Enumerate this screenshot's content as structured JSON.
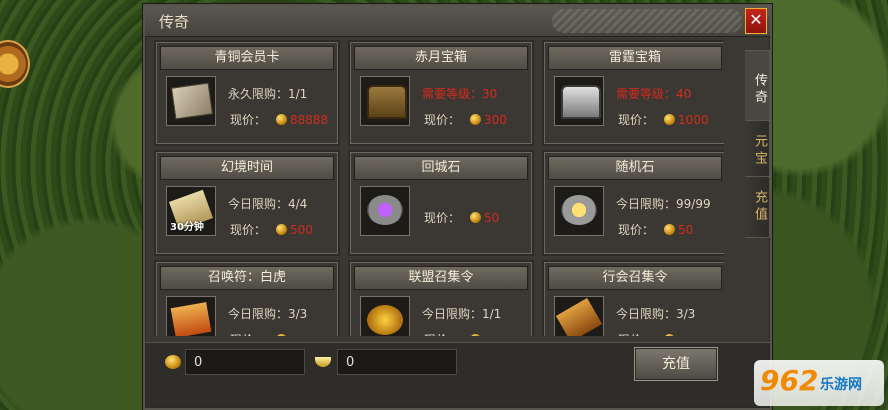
{
  "window": {
    "title": "传奇",
    "close_glyph": "✕"
  },
  "tabs": [
    {
      "label": "传奇",
      "active": true
    },
    {
      "label": "元宝",
      "active": false
    },
    {
      "label": "充值",
      "active": false
    }
  ],
  "price_label": "现价：",
  "items": [
    {
      "name": "青铜会员卡",
      "line1": "永久限购：1/1",
      "line1_red": false,
      "price": "88888",
      "icon": "bronze-card-icon"
    },
    {
      "name": "赤月宝箱",
      "line1": "需要等级：30",
      "line1_red": true,
      "price": "300",
      "icon": "treasure-chest-icon"
    },
    {
      "name": "雷霆宝箱",
      "line1": "需要等级：40",
      "line1_red": true,
      "price": "1000",
      "icon": "silver-chest-icon"
    },
    {
      "name": "幻境时间",
      "line1": "今日限购：4/4",
      "line1_red": false,
      "price": "500",
      "icon": "scroll-icon",
      "icon_text": "30分钟"
    },
    {
      "name": "回城石",
      "line1": "",
      "line1_red": false,
      "price": "50",
      "icon": "return-stone-icon"
    },
    {
      "name": "随机石",
      "line1": "今日限购：99/99",
      "line1_red": false,
      "price": "50",
      "icon": "random-stone-icon"
    },
    {
      "name": "召唤符：白虎",
      "line1": "今日限购：3/3",
      "line1_red": false,
      "price": "",
      "icon": "summon-talisman-icon"
    },
    {
      "name": "联盟召集令",
      "line1": "今日限购：1/1",
      "line1_red": false,
      "price": "",
      "icon": "alliance-token-icon"
    },
    {
      "name": "行会召集令",
      "line1": "今日限购：3/3",
      "line1_red": false,
      "price": "",
      "icon": "guild-token-icon"
    }
  ],
  "bottom": {
    "gold_value": "0",
    "yuanbao_value": "0",
    "recharge_label": "充值"
  },
  "watermark": {
    "num": "962",
    "text": "乐游网"
  },
  "colors": {
    "price_red": "#d42a1e",
    "text_light": "#ddd6c2",
    "panel_bg": "#3a3833"
  }
}
